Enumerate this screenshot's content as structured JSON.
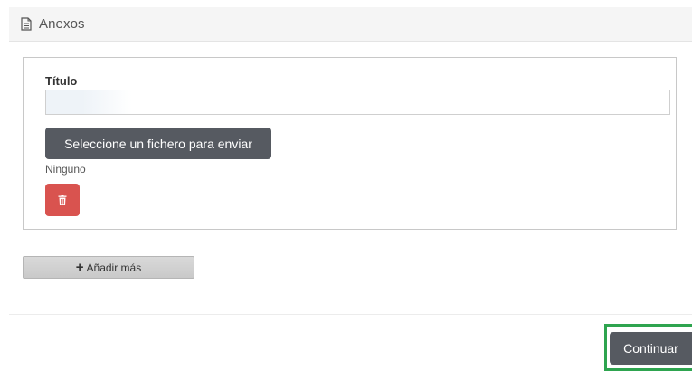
{
  "panel": {
    "title": "Anexos",
    "icon": "document-icon"
  },
  "attachment": {
    "title_label": "Título",
    "title_value": "",
    "title_placeholder": "",
    "file_button_label": "Seleccione un fichero para enviar",
    "file_status": "Ninguno",
    "delete_icon": "trash-icon"
  },
  "actions": {
    "add_more_label": "Añadir más",
    "add_more_icon": "plus-icon",
    "continue_label": "Continuar"
  },
  "colors": {
    "dark_button": "#565a61",
    "danger_button": "#d9534f",
    "highlight": "#2ea44f"
  }
}
